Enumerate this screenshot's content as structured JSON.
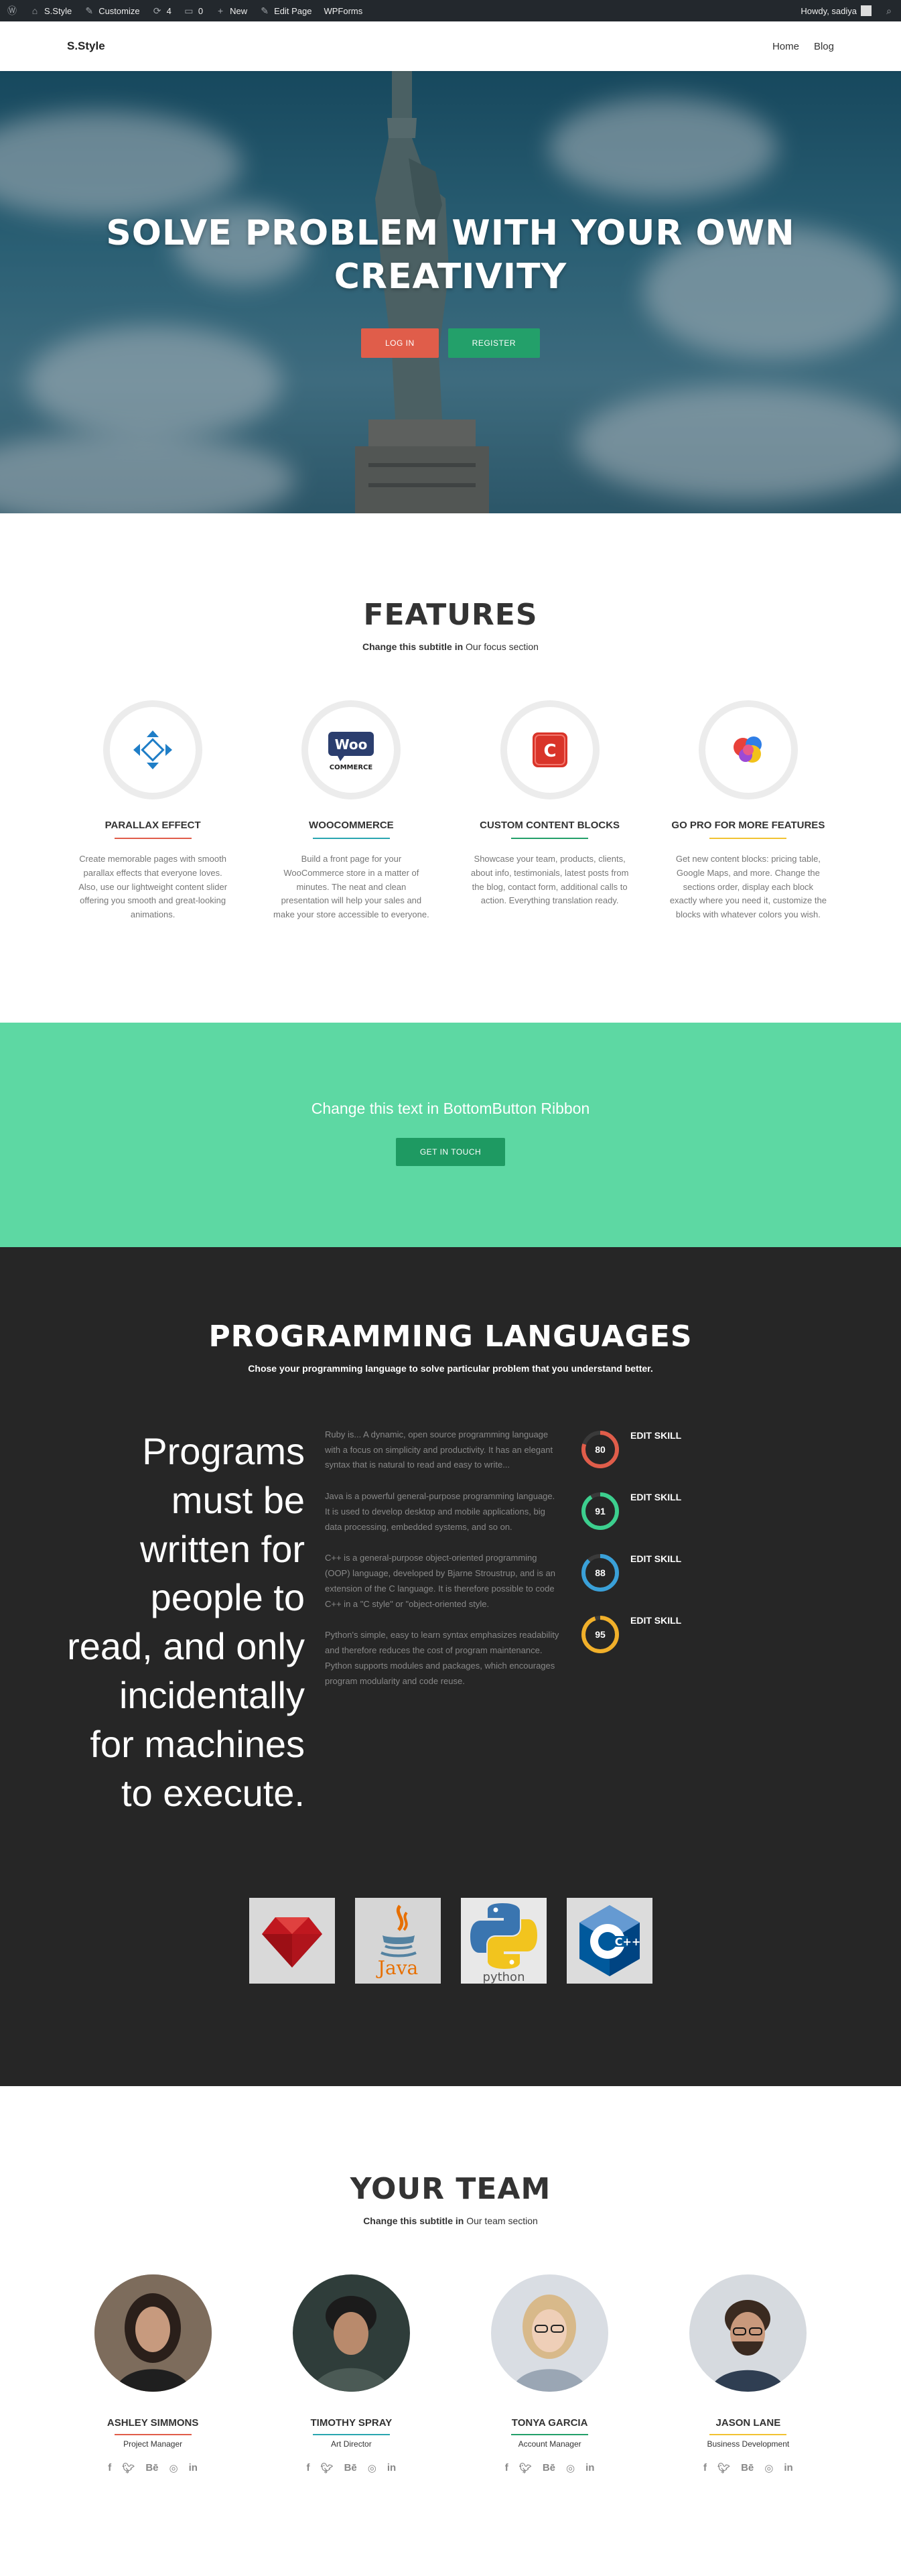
{
  "adminbar": {
    "site_name": "S.Style",
    "customize": "Customize",
    "updates_count": "4",
    "comments_count": "0",
    "new_label": "New",
    "edit_page": "Edit Page",
    "wpforms": "WPForms",
    "howdy": "Howdy, sadiya"
  },
  "header": {
    "logo": "S.Style",
    "nav": [
      {
        "label": "Home"
      },
      {
        "label": "Blog"
      }
    ]
  },
  "hero": {
    "title": "SOLVE PROBLEM WITH YOUR OWN CREATIVITY",
    "login": "LOG IN",
    "register": "REGISTER"
  },
  "features": {
    "title": "FEATURES",
    "subtitle_bold": "Change this subtitle in",
    "subtitle_rest": " Our focus section",
    "items": [
      {
        "title": "PARALLAX EFFECT",
        "line_color": "#e05d4a",
        "icon": "parallax-arrows-icon",
        "text": "Create memorable pages with smooth parallax effects that everyone loves. Also, use our lightweight content slider offering you smooth and great-looking animations."
      },
      {
        "title": "WOOCOMMERCE",
        "line_color": "#2aa6b0",
        "icon": "woocommerce-icon",
        "text": "Build a front page for your WooCommerce store in a matter of minutes. The neat and clean presentation will help your sales and make your store accessible to everyone."
      },
      {
        "title": "CUSTOM CONTENT BLOCKS",
        "line_color": "#23a06a",
        "icon": "content-blocks-icon",
        "text": "Showcase your team, products, clients, about info, testimonials, latest posts from the blog, contact form, additional calls to action. Everything translation ready."
      },
      {
        "title": "GO PRO FOR MORE FEATURES",
        "line_color": "#f1c232",
        "icon": "pro-badge-icon",
        "text": "Get new content blocks: pricing table, Google Maps, and more. Change the sections order, display each block exactly where you need it, customize the blocks with whatever colors you wish."
      }
    ]
  },
  "ribbon": {
    "text": "Change this text in BottomButton Ribbon",
    "button": "GET IN TOUCH"
  },
  "programming": {
    "title": "PROGRAMMING LANGUAGES",
    "subtitle": "Chose your programming language to solve particular problem that you understand better.",
    "quote": "Programs must be written for people to read, and only incidentally for machines to execute.",
    "descriptions": [
      "Ruby is... A dynamic, open source programming language with a focus on simplicity and productivity. It has an elegant syntax that is natural to read and easy to write...",
      "Java is a powerful general-purpose programming language. It is used to develop desktop and mobile applications, big data processing, embedded systems, and so on.",
      "C++ is a general-purpose object-oriented programming (OOP) language, developed by Bjarne Stroustrup, and is an extension of the C language. It is therefore possible to code C++ in a \"C style\" or \"object-oriented style.",
      "Python's simple, easy to learn syntax emphasizes readability and therefore reduces the cost of program maintenance. Python supports modules and packages, which encourages program modularity and code reuse."
    ],
    "skills": [
      {
        "value": "80",
        "label": "EDIT SKILL",
        "color": "#e05d4a"
      },
      {
        "value": "91",
        "label": "EDIT SKILL",
        "color": "#3ccf8e"
      },
      {
        "value": "88",
        "label": "EDIT SKILL",
        "color": "#3aa0d8"
      },
      {
        "value": "95",
        "label": "EDIT SKILL",
        "color": "#f1b02a"
      }
    ],
    "logos": [
      {
        "icon": "ruby-logo-icon"
      },
      {
        "icon": "java-logo-icon",
        "text": "Java"
      },
      {
        "icon": "python-logo-icon",
        "text": "python"
      },
      {
        "icon": "cpp-logo-icon",
        "text": "C++"
      }
    ]
  },
  "team": {
    "title": "YOUR TEAM",
    "subtitle_bold": "Change this subtitle in",
    "subtitle_rest": " Our team section",
    "members": [
      {
        "name": "ASHLEY SIMMONS",
        "role": "Project Manager",
        "line_color": "#e05d4a"
      },
      {
        "name": "TIMOTHY SPRAY",
        "role": "Art Director",
        "line_color": "#2aa6b0"
      },
      {
        "name": "TONYA GARCIA",
        "role": "Account Manager",
        "line_color": "#23a06a"
      },
      {
        "name": "JASON LANE",
        "role": "Business Development",
        "line_color": "#f1c232"
      }
    ],
    "social_icons": [
      "facebook-icon",
      "twitter-icon",
      "behance-icon",
      "dribbble-icon",
      "linkedin-icon"
    ]
  }
}
